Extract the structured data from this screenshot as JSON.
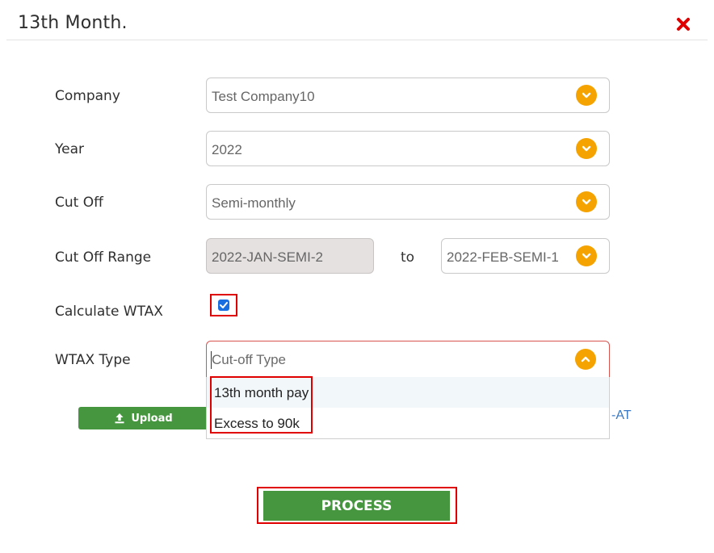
{
  "modal": {
    "title": "13th Month.",
    "close_icon": "close-x-icon",
    "accent_close_color": "#e00000"
  },
  "form": {
    "company": {
      "label": "Company",
      "value": "Test Company10"
    },
    "year": {
      "label": "Year",
      "value": "2022"
    },
    "cutoff": {
      "label": "Cut Off",
      "value": "Semi-monthly"
    },
    "cutoff_range": {
      "label": "Cut Off Range",
      "from": "2022-JAN-SEMI-2",
      "to_label": "to",
      "to": "2022-FEB-SEMI-1"
    },
    "calculate_wtax": {
      "label": "Calculate WTAX",
      "checked": true
    },
    "wtax_type": {
      "label": "WTAX Type",
      "placeholder": "Cut-off Type",
      "options": [
        "13th month pay",
        "Excess to 90k"
      ]
    }
  },
  "upload": {
    "label": "Upload",
    "icon": "upload-icon"
  },
  "partial_text": "-AT",
  "process": {
    "label": "PROCESS"
  },
  "colors": {
    "dropdown_chevron": "#f5a300",
    "primary_button": "#46963f",
    "highlight_border": "#e00000"
  }
}
